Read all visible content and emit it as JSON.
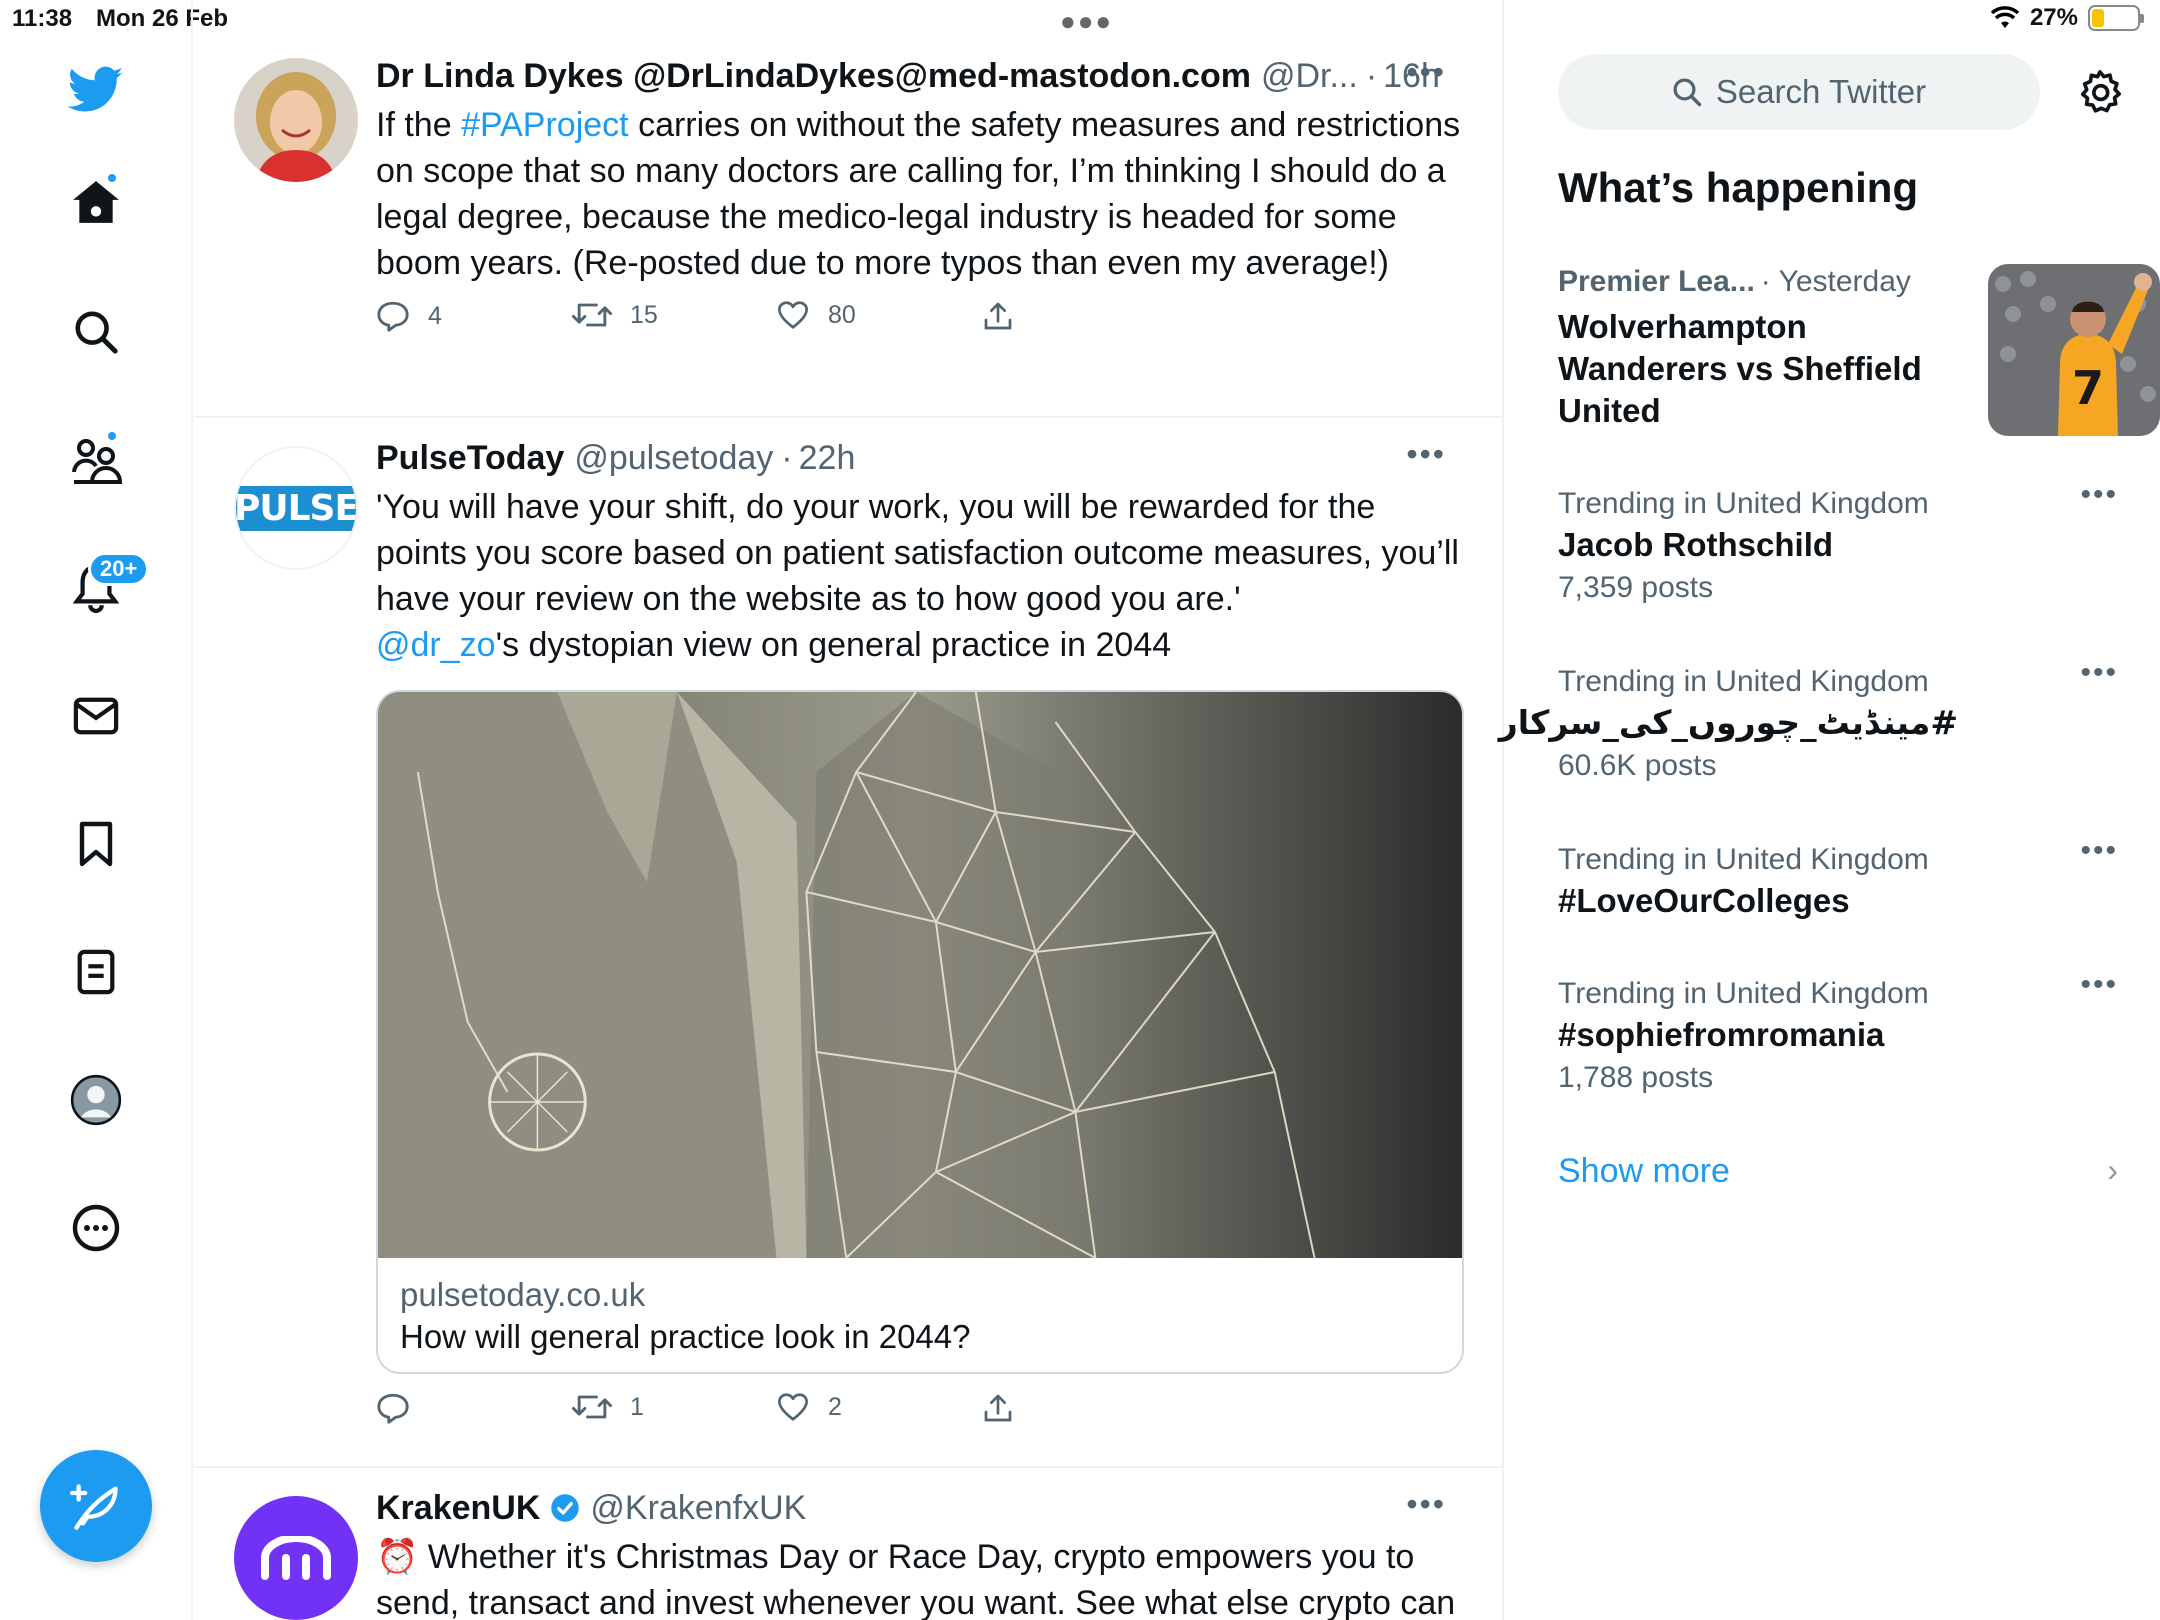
{
  "status": {
    "time": "11:38",
    "date": "Mon 26 Feb",
    "battery": "27%",
    "battery_level": 0.27
  },
  "nav": {
    "notifications_badge": "20+"
  },
  "tweets": [
    {
      "name": "Dr Linda Dykes @DrLindaDykes@med-mastodon.com",
      "handle": "@Dr...",
      "time": "16h",
      "text_before": "If the ",
      "hashtag": "#PAProject",
      "text_after": " carries on without the safety measures and restrictions on scope that so many doctors are calling for, I’m thinking I should do a legal degree, because the medico-legal industry is headed for some boom years. (Re-posted due to more typos than even my average!)",
      "replies": "4",
      "retweets": "15",
      "likes": "80"
    },
    {
      "name": "PulseToday",
      "handle": "@pulsetoday",
      "time": "22h",
      "avatar_text": "PULSE",
      "text_main": "'You will have your shift, do your work, you will be rewarded for the points you score based on patient satisfaction outcome measures, you’ll have your review on the website as to how good you are.'",
      "mention": "@dr_zo",
      "text_after": "'s dystopian view on general practice in 2044",
      "card_domain": "pulsetoday.co.uk",
      "card_title": "How will general practice look in 2044?",
      "replies": "",
      "retweets": "1",
      "likes": "2"
    },
    {
      "name": "KrakenUK",
      "handle": "@KrakenfxUK",
      "text": "⏰ Whether it's Christmas Day or Race Day, crypto empowers you to send, transact and invest whenever you want. See what else crypto can"
    }
  ],
  "sidebar": {
    "search_placeholder": "Search Twitter",
    "whats_happening": "What’s happening",
    "featured": {
      "category": "Premier Lea...",
      "time": "· Yesterday",
      "title": "Wolverhampton Wanderers vs Sheffield United",
      "image_text": "7"
    },
    "trends": [
      {
        "category": "Trending in United Kingdom",
        "name": "Jacob Rothschild",
        "count": "7,359 posts"
      },
      {
        "category": "Trending in United Kingdom",
        "name": "#مینڈیٹ_چوروں_کی_سرکار",
        "count": "60.6K posts"
      },
      {
        "category": "Trending in United Kingdom",
        "name": "#LoveOurColleges",
        "count": ""
      },
      {
        "category": "Trending in United Kingdom",
        "name": "#sophiefromromania",
        "count": "1,788 posts"
      }
    ],
    "show_more": "Show more"
  },
  "colors": {
    "accent": "#1d9bf0",
    "text": "#0f1419",
    "muted": "#536471",
    "border": "#eff3f4"
  }
}
